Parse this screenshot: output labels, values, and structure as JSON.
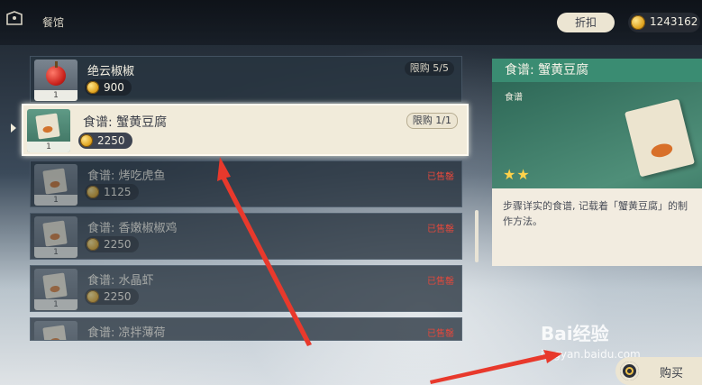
{
  "header": {
    "title": "餐馆",
    "discount_label": "折扣",
    "currency_value": "1243162"
  },
  "list": {
    "items": [
      {
        "name": "绝云椒椒",
        "price": "900",
        "count": "1",
        "limit": "限购 5/5",
        "sold": "",
        "icon": "jueyun-chili-icon"
      },
      {
        "name": "食谱: 蟹黄豆腐",
        "price": "2250",
        "count": "1",
        "limit": "限购 1/1",
        "sold": "",
        "icon": "recipe-icon"
      },
      {
        "name": "食谱: 烤吃虎鱼",
        "price": "1125",
        "count": "1",
        "limit": "",
        "sold": "已售罄",
        "icon": "recipe-icon"
      },
      {
        "name": "食谱: 香嫩椒椒鸡",
        "price": "2250",
        "count": "1",
        "limit": "",
        "sold": "已售罄",
        "icon": "recipe-icon"
      },
      {
        "name": "食谱: 水晶虾",
        "price": "2250",
        "count": "1",
        "limit": "",
        "sold": "已售罄",
        "icon": "recipe-icon"
      },
      {
        "name": "食谱: 凉拌薄荷",
        "price": "",
        "count": "",
        "limit": "",
        "sold": "已售罄",
        "icon": "recipe-icon"
      }
    ]
  },
  "detail": {
    "title": "食谱: 蟹黄豆腐",
    "type": "食谱",
    "stars": "★★",
    "description": "步骤详实的食谱, 记载着「蟹黄豆腐」的制作方法。"
  },
  "buy": {
    "label": "购买"
  },
  "watermark": {
    "brand": "Bai经验",
    "url": "jingyan.baidu.com"
  },
  "colors": {
    "accent_green": "#3a8c72",
    "sold_red": "#e0483c",
    "arrow_red": "#e8392c"
  }
}
